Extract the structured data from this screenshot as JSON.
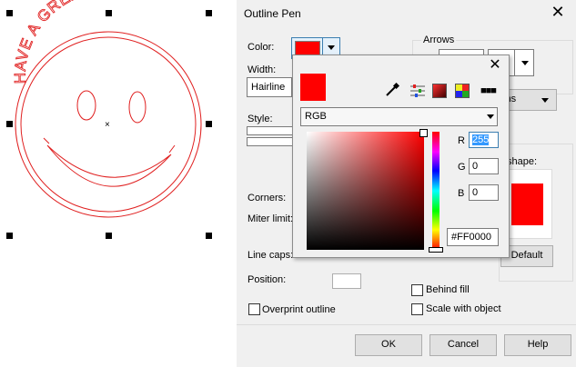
{
  "canvas": {
    "top_text": "HAVE A GREAT DAY!"
  },
  "dialog": {
    "title": "Outline Pen",
    "color_label": "Color:",
    "width_label": "Width:",
    "width_value": "Hairline",
    "style_label": "Style:",
    "corners_label": "Corners:",
    "miter_label": "Miter limit:",
    "linecaps_label": "Line caps:",
    "position_label": "Position:",
    "arrows_label": "Arrows",
    "options_partial": "ions",
    "shape_label": "shape:",
    "default_label": "Default",
    "behind_fill": "Behind fill",
    "scale_with_object": "Scale with object",
    "overprint_outline": "Overprint outline",
    "ok": "OK",
    "cancel": "Cancel",
    "help": "Help",
    "colors": {
      "outline": "#ff0000"
    }
  },
  "color_popup": {
    "model": "RGB",
    "r_label": "R",
    "g_label": "G",
    "b_label": "B",
    "r": "255",
    "g": "0",
    "b": "0",
    "hex": "#FF0000",
    "swatch": "#ff0000"
  }
}
